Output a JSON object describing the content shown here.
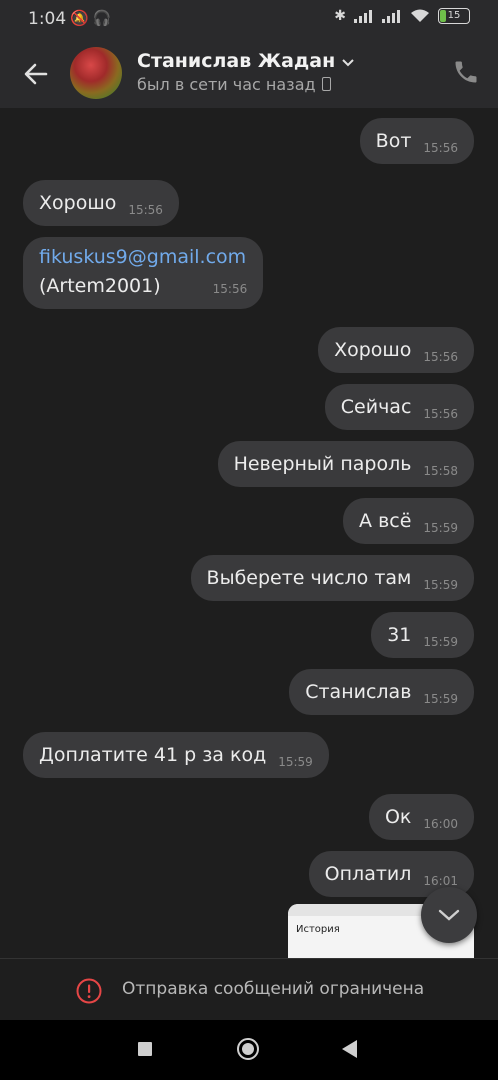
{
  "status_bar": {
    "time": "1:04",
    "battery": "15"
  },
  "header": {
    "name": "Станислав Жадан",
    "status": "был в сети час назад"
  },
  "messages": [
    {
      "text": "Вот",
      "time": "15:56",
      "side": "out"
    },
    {
      "text": "Хорошо",
      "time": "15:56",
      "side": "in"
    },
    {
      "link": "fikuskus9@gmail.com",
      "text": "(Artem2001)",
      "time": "15:56",
      "side": "in"
    },
    {
      "text": "Хорошо",
      "time": "15:56",
      "side": "out"
    },
    {
      "text": "Сейчас",
      "time": "15:56",
      "side": "out"
    },
    {
      "text": "Неверный пароль",
      "time": "15:58",
      "side": "out"
    },
    {
      "text": "А всё",
      "time": "15:59",
      "side": "out"
    },
    {
      "text": "Выберете число там",
      "time": "15:59",
      "side": "out"
    },
    {
      "text": "31",
      "time": "15:59",
      "side": "out"
    },
    {
      "text": "Станислав",
      "time": "15:59",
      "side": "out"
    },
    {
      "text": "Доплатите 41 р за код",
      "time": "15:59",
      "side": "in"
    },
    {
      "text": "Ок",
      "time": "16:00",
      "side": "out"
    },
    {
      "text": "Оплатил",
      "time": "16:01",
      "side": "out"
    }
  ],
  "attachment": {
    "title": "История"
  },
  "footer": {
    "restricted_text": "Отправка сообщений ограничена"
  },
  "colors": {
    "background": "#1e1e1e",
    "bubble": "#3a3a3c",
    "link": "#71aaeb",
    "alert": "#e64646"
  }
}
